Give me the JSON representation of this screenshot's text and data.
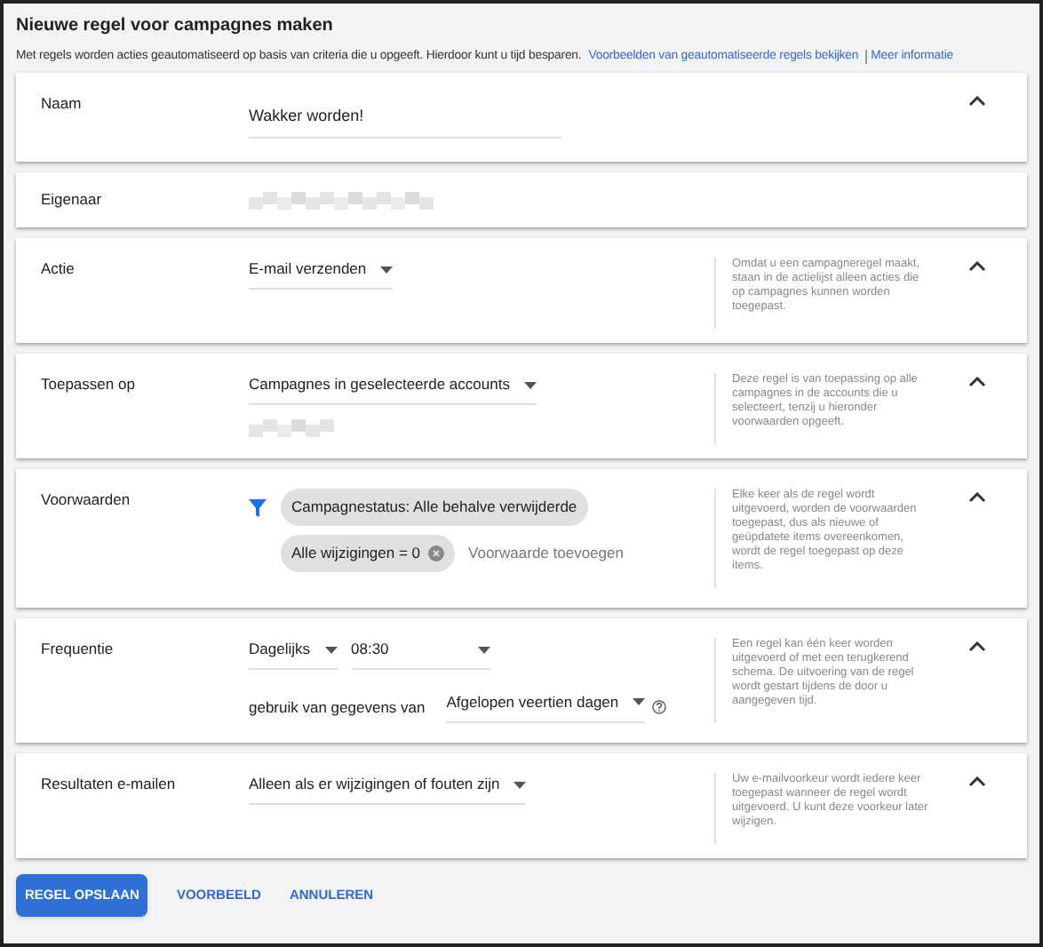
{
  "title": "Nieuwe regel voor campagnes maken",
  "intro": {
    "text": "Met regels worden acties geautomatiseerd op basis van criteria die u opgeeft. Hierdoor kunt u tijd besparen.",
    "links": [
      "Voorbeelden van geautomatiseerde regels bekijken",
      "Meer informatie"
    ]
  },
  "sections": [
    {
      "kind": "text_field",
      "label": "Naam",
      "value": "Wakker worden!"
    },
    {
      "kind": "redacted",
      "label": "Eigenaar"
    },
    {
      "kind": "dropdown",
      "label": "Actie",
      "value": "E-mail verzenden",
      "help": "Omdat u een campagneregel maakt, staan in de actielijst alleen acties die op campagnes kunnen worden toegepast."
    },
    {
      "kind": "dropdown_redacted",
      "label": "Toepassen op",
      "value": "Campagnes in geselecteerde accounts",
      "help": "Deze regel is van toepassing op alle campagnes in de accounts die u selecteert, tenzij u hieronder voorwaarden opgeeft."
    },
    {
      "kind": "conditions",
      "label": "Voorwaarden",
      "chips": [
        {
          "text": "Campagnestatus: Alle behalve verwijderde",
          "removable": false
        },
        {
          "text": "Alle wijzigingen = 0",
          "removable": true
        }
      ],
      "add": "Voorwaarde toevoegen",
      "help": "Elke keer als de regel wordt uitgevoerd, worden de voorwaarden toegepast, dus als nieuwe of geüpdatete items overeenkomen, wordt de regel toegepast op deze items."
    },
    {
      "kind": "frequency",
      "label": "Frequentie",
      "frequency": "Dagelijks",
      "time": "08:30",
      "data_label": "gebruik van gegevens van",
      "data_range": "Afgelopen veertien dagen",
      "help": "Een regel kan één keer worden uitgevoerd of met een terugkerend schema. De uitvoering van de regel wordt gestart tijdens de door u aangegeven tijd."
    },
    {
      "kind": "dropdown",
      "label": "Resultaten e-mailen",
      "value": "Alleen als er wijzigingen of fouten zijn",
      "help": "Uw e-mailvoorkeur wordt iedere keer toegepast wanneer de regel wordt uitgevoerd. U kunt deze voorkeur later wijzigen."
    }
  ],
  "buttons": [
    {
      "label": "REGEL OPSLAAN",
      "kind": "primary"
    },
    {
      "label": "VOORBEELD",
      "kind": "text"
    },
    {
      "label": "ANNULEREN",
      "kind": "text"
    }
  ]
}
